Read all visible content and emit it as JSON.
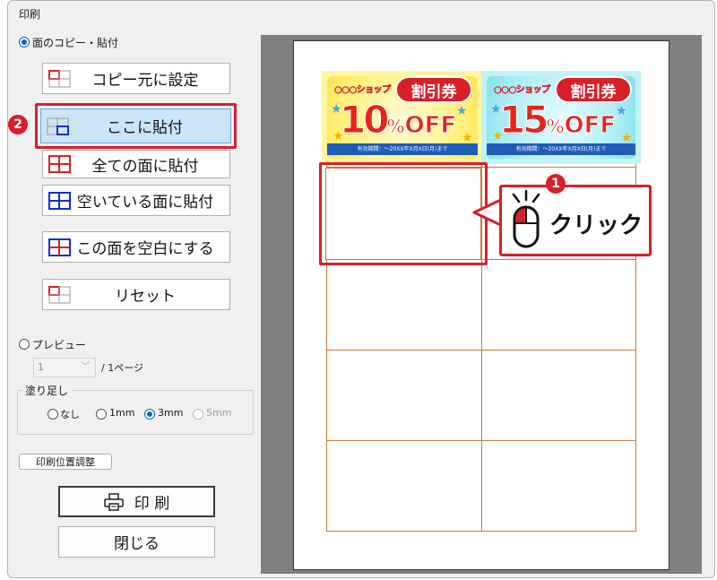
{
  "window": {
    "title": "印刷"
  },
  "mode_copy": {
    "label": "面のコピー・貼付",
    "checked": true
  },
  "buttons": {
    "set_source": "コピー元に設定",
    "paste_here": "ここに貼付",
    "paste_all": "全ての面に貼付",
    "paste_empty": "空いている面に貼付",
    "blank_face": "この面を空白にする",
    "reset": "リセット"
  },
  "mode_preview": {
    "label": "プレビュー",
    "checked": false
  },
  "page_select": {
    "value": "1",
    "suffix": "/ 1ページ"
  },
  "bleed": {
    "title": "塗り足し",
    "options": [
      {
        "label": "なし",
        "checked": false,
        "disabled": false
      },
      {
        "label": "1mm",
        "checked": false,
        "disabled": false
      },
      {
        "label": "3mm",
        "checked": true,
        "disabled": false
      },
      {
        "label": "5mm",
        "checked": false,
        "disabled": true
      }
    ]
  },
  "position_adjust": "印刷位置調整",
  "print_button": "印 刷",
  "close_button": "閉じる",
  "steps": {
    "one": "1",
    "two": "2"
  },
  "callout": {
    "text": "クリック"
  },
  "coupons": [
    {
      "shop": "○○○ショップ",
      "badge": "割引券",
      "number": "10",
      "percent": "%",
      "off": "OFF",
      "validity": "有効期間：〜20XX年X月X日(月)まで"
    },
    {
      "shop": "○○○ショップ",
      "badge": "割引券",
      "number": "15",
      "percent": "%",
      "off": "OFF",
      "validity": "有効期間：〜20XX年X月X日(月)まで"
    }
  ],
  "colors": {
    "accent_red": "#d7202a",
    "selected_blue": "#cce4f7",
    "grid_line": "#c47a3c"
  }
}
